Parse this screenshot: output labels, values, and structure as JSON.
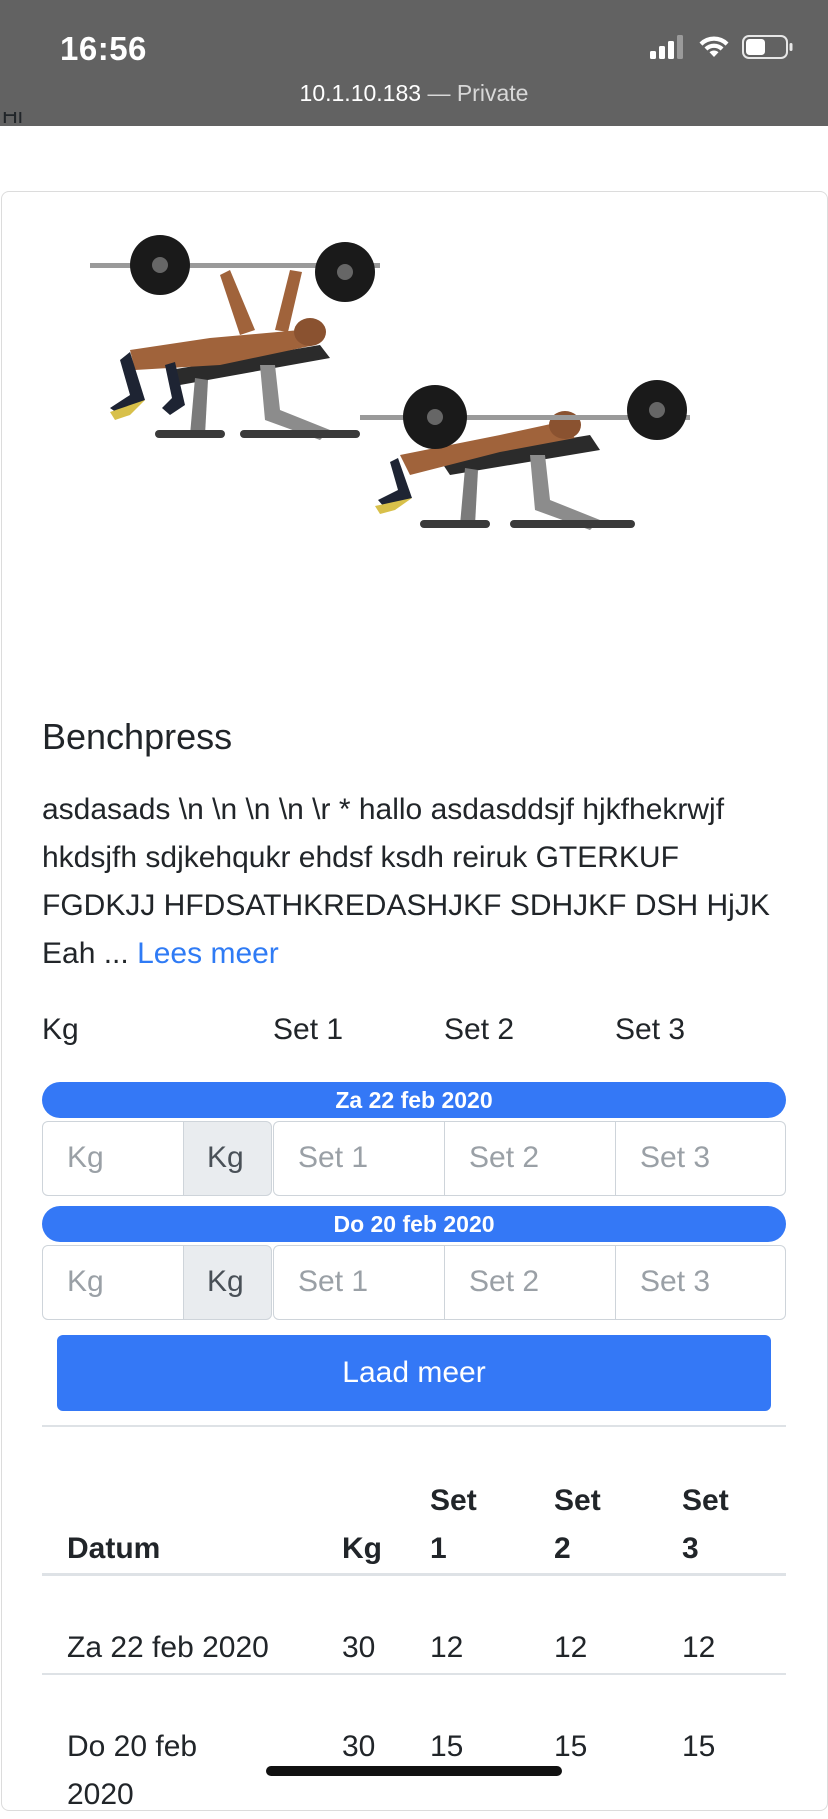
{
  "status_bar": {
    "time": "16:56",
    "url_host": "10.1.10.183",
    "url_separator": " — ",
    "url_mode": "Private",
    "battery_level": 0.5
  },
  "clipped_heading": "Hi",
  "exercise": {
    "title": "Benchpress",
    "description": "asdasads \\n \\n \\n \\n \\r * hallo asdasddsjf hjkfhekrwjf hkdsjfh sdjkehqukr ehdsf ksdh reiruk GTERKUF FGDKJJ HFDSATHKREDASHJKF SDHJKF DSH HjJK Eah ...",
    "read_more": "Lees meer"
  },
  "columns": {
    "kg": "Kg",
    "set1": "Set 1",
    "set2": "Set 2",
    "set3": "Set 3"
  },
  "entries": [
    {
      "date": "Za 22 feb 2020",
      "kg_placeholder": "Kg",
      "kg_addon": "Kg",
      "set1_placeholder": "Set 1",
      "set2_placeholder": "Set 2",
      "set3_placeholder": "Set 3"
    },
    {
      "date": "Do 20 feb 2020",
      "kg_placeholder": "Kg",
      "kg_addon": "Kg",
      "set1_placeholder": "Set 1",
      "set2_placeholder": "Set 2",
      "set3_placeholder": "Set 3"
    }
  ],
  "load_more": "Laad meer",
  "history": {
    "headers": {
      "date": "Datum",
      "kg": "Kg",
      "set1_a": "Set",
      "set1_b": "1",
      "set2_a": "Set",
      "set2_b": "2",
      "set3_a": "Set",
      "set3_b": "3"
    },
    "rows": [
      {
        "date_a": "Za 22 feb 2020",
        "date_b": "",
        "kg": "30",
        "set1": "12",
        "set2": "12",
        "set3": "12"
      },
      {
        "date_a": "Do 20 feb",
        "date_b": "2020",
        "kg": "30",
        "set1": "15",
        "set2": "15",
        "set3": "15"
      }
    ]
  },
  "colors": {
    "primary": "#3478f6",
    "status_bar": "#626262",
    "link": "#2f7bf5"
  },
  "icons": {
    "signal": "cellular-signal-icon",
    "wifi": "wifi-icon",
    "battery": "battery-icon"
  }
}
